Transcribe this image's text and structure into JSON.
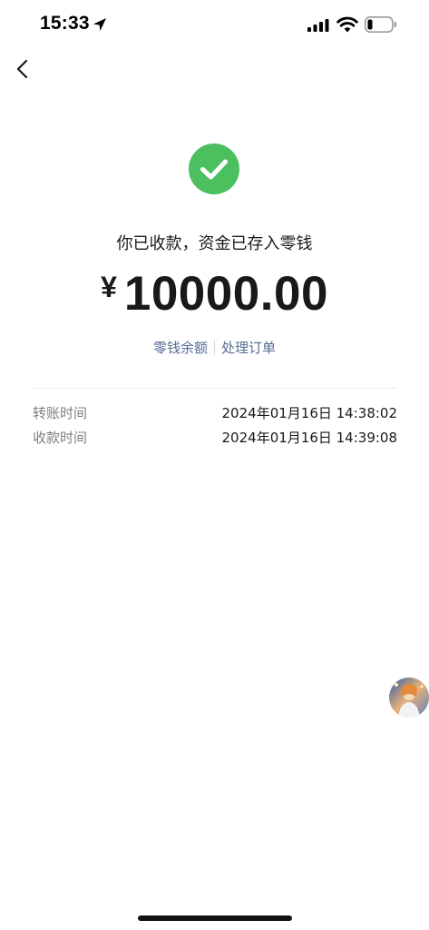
{
  "status_bar": {
    "time": "15:33",
    "icons": [
      "location-arrow-icon",
      "signal-icon",
      "wifi-icon",
      "battery-icon"
    ],
    "battery_level": 0.2
  },
  "nav": {
    "back_icon": "chevron-left-icon"
  },
  "result": {
    "icon": "check-circle-icon",
    "icon_color": "#4cbf5f",
    "message": "你已收款，资金已存入零钱",
    "currency_symbol": "¥",
    "amount": "10000.00"
  },
  "links": {
    "balance": "零钱余额",
    "process_order": "处理订单",
    "color": "#576b95"
  },
  "details": [
    {
      "label": "转账时间",
      "value": "2024年01月16日 14:38:02"
    },
    {
      "label": "收款时间",
      "value": "2024年01月16日 14:39:08"
    }
  ],
  "floating_avatar": {
    "icon": "avatar-image"
  }
}
